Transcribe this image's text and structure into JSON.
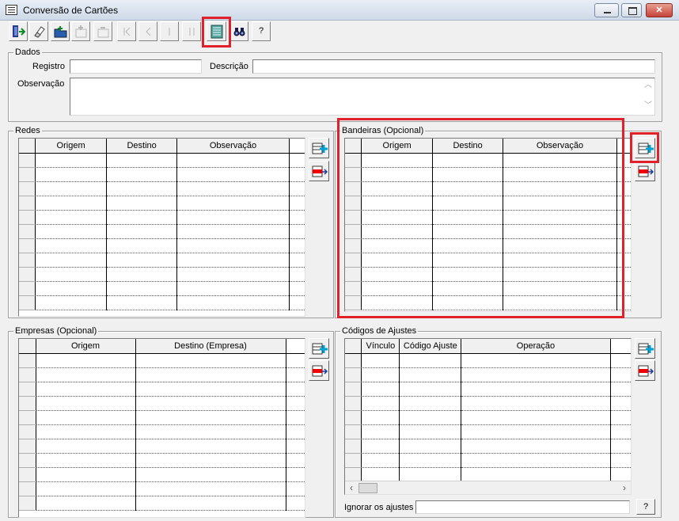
{
  "window": {
    "title": "Conversão de Cartões"
  },
  "toolbar": {
    "buttons": [
      {
        "name": "exit-icon"
      },
      {
        "name": "eraser-icon"
      },
      {
        "name": "add-folder-icon"
      },
      {
        "name": "add-record-icon"
      },
      {
        "name": "remove-record-icon"
      },
      {
        "name": "first-icon"
      },
      {
        "name": "prev-icon"
      },
      {
        "name": "next-icon"
      },
      {
        "name": "last-icon"
      },
      {
        "name": "list-icon"
      },
      {
        "name": "binoculars-icon"
      },
      {
        "name": "help-button",
        "label": "?"
      }
    ]
  },
  "dados": {
    "legend": "Dados",
    "registro_label": "Registro",
    "registro_value": "",
    "descricao_label": "Descrição",
    "descricao_value": "",
    "observacao_label": "Observação",
    "observacao_value": ""
  },
  "redes": {
    "legend": "Redes",
    "columns": [
      "Origem",
      "Destino",
      "Observação"
    ],
    "rows": 11
  },
  "bandeiras": {
    "legend": "Bandeiras (Opcional)",
    "columns": [
      "Origem",
      "Destino",
      "Observação"
    ],
    "rows": 11
  },
  "empresas": {
    "legend": "Empresas (Opcional)",
    "columns": [
      "Origem",
      "Destino (Empresa)"
    ],
    "rows": 11
  },
  "codigos": {
    "legend": "Códigos de Ajustes",
    "columns": [
      "Vínculo",
      "Código Ajuste",
      "Operação"
    ],
    "rows": 9,
    "ignorar_label": "Ignorar os ajustes",
    "ignorar_value": "",
    "help_label": "?"
  },
  "colors": {
    "highlight": "#e0202a",
    "background": "#f0f0f0"
  }
}
